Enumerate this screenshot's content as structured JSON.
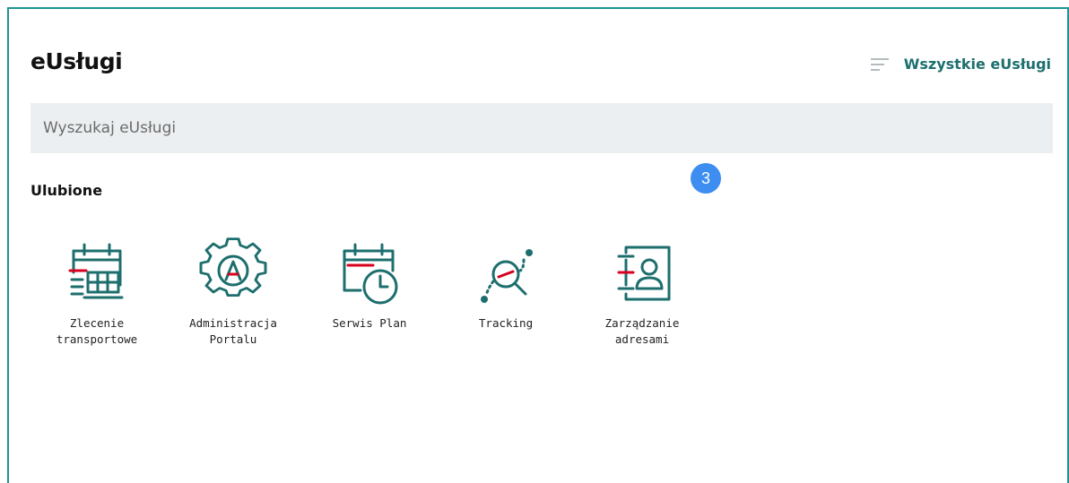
{
  "header": {
    "title": "eUsługi",
    "all_services_label": "Wszystkie eUsługi"
  },
  "search": {
    "placeholder": "Wyszukaj eUsługi"
  },
  "favorites": {
    "heading": "Ulubione",
    "badge_count": "3",
    "items": [
      {
        "label_line1": "Zlecenie",
        "label_line2": "transportowe",
        "icon": "transport-order-icon"
      },
      {
        "label_line1": "Administracja",
        "label_line2": "Portalu",
        "icon": "portal-admin-icon"
      },
      {
        "label_line1": "Serwis Plan",
        "label_line2": "",
        "icon": "service-plan-icon"
      },
      {
        "label_line1": "Tracking",
        "label_line2": "",
        "icon": "tracking-icon"
      },
      {
        "label_line1": "Zarządzanie",
        "label_line2": "adresami",
        "icon": "address-management-icon"
      }
    ]
  },
  "colors": {
    "accent_teal": "#1e6e6e",
    "accent_red": "#d7001e",
    "border_teal": "#1e9494",
    "badge_blue": "#3d8ef0",
    "search_bg": "#eceff1"
  }
}
